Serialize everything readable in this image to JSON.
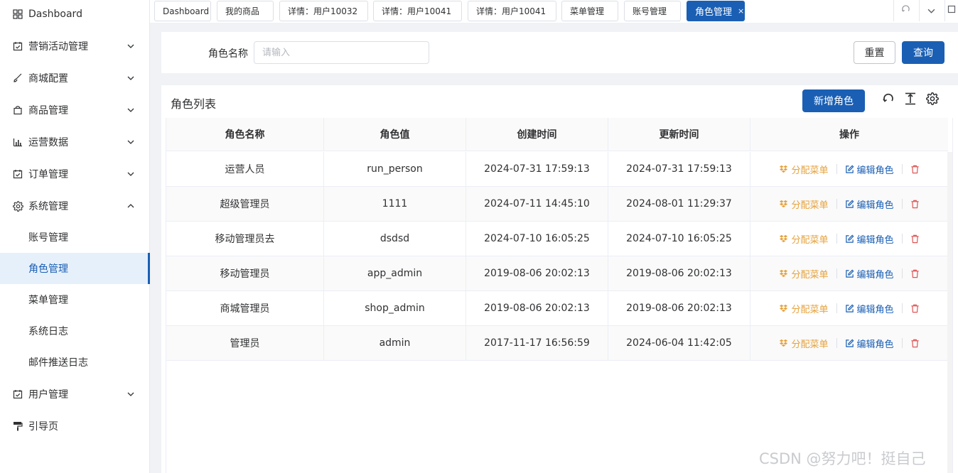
{
  "sidebar": {
    "items": [
      {
        "label": "Dashboard"
      },
      {
        "label": "营销活动管理"
      },
      {
        "label": "商城配置"
      },
      {
        "label": "商品管理"
      },
      {
        "label": "运营数据"
      },
      {
        "label": "订单管理"
      },
      {
        "label": "系统管理"
      },
      {
        "label": "用户管理"
      },
      {
        "label": "引导页"
      }
    ],
    "sub_items": [
      {
        "label": "账号管理"
      },
      {
        "label": "角色管理"
      },
      {
        "label": "菜单管理"
      },
      {
        "label": "系统日志"
      },
      {
        "label": "邮件推送日志"
      }
    ]
  },
  "tabs": [
    {
      "label": "Dashboard"
    },
    {
      "label": "我的商品"
    },
    {
      "label": "详情：用户10032"
    },
    {
      "label": "详情：用户10041"
    },
    {
      "label": "详情：用户10041"
    },
    {
      "label": "菜单管理"
    },
    {
      "label": "账号管理"
    },
    {
      "label": "角色管理",
      "close": "×"
    }
  ],
  "search": {
    "label": "角色名称",
    "placeholder": "请输入",
    "value": "",
    "reset_label": "重置",
    "query_label": "查询"
  },
  "table_card": {
    "title": "角色列表",
    "add_label": "新增角色"
  },
  "table": {
    "columns": [
      "角色名称",
      "角色值",
      "创建时间",
      "更新时间",
      "操作"
    ],
    "rows": [
      {
        "name": "运营人员",
        "value": "run_person",
        "created": "2024-07-31 17:59:13",
        "updated": "2024-07-31 17:59:13"
      },
      {
        "name": "超级管理员",
        "value": "1111",
        "created": "2024-07-11 14:45:10",
        "updated": "2024-08-01 11:29:37"
      },
      {
        "name": "移动管理员去",
        "value": "dsdsd",
        "created": "2024-07-10 16:05:25",
        "updated": "2024-07-10 16:05:25"
      },
      {
        "name": "移动管理员",
        "value": "app_admin",
        "created": "2019-08-06 20:02:13",
        "updated": "2019-08-06 20:02:13"
      },
      {
        "name": "商城管理员",
        "value": "shop_admin",
        "created": "2019-08-06 20:02:13",
        "updated": "2019-08-06 20:02:13"
      },
      {
        "name": "管理员",
        "value": "admin",
        "created": "2017-11-17 16:56:59",
        "updated": "2024-06-04 11:42:05"
      }
    ],
    "actions": {
      "assign": "分配菜单",
      "edit": "编辑角色"
    }
  },
  "watermark": "CSDN @努力吧！挺自己",
  "colors": {
    "primary": "#1a5fb4",
    "warning": "#e6a23c",
    "danger": "#e05555"
  }
}
